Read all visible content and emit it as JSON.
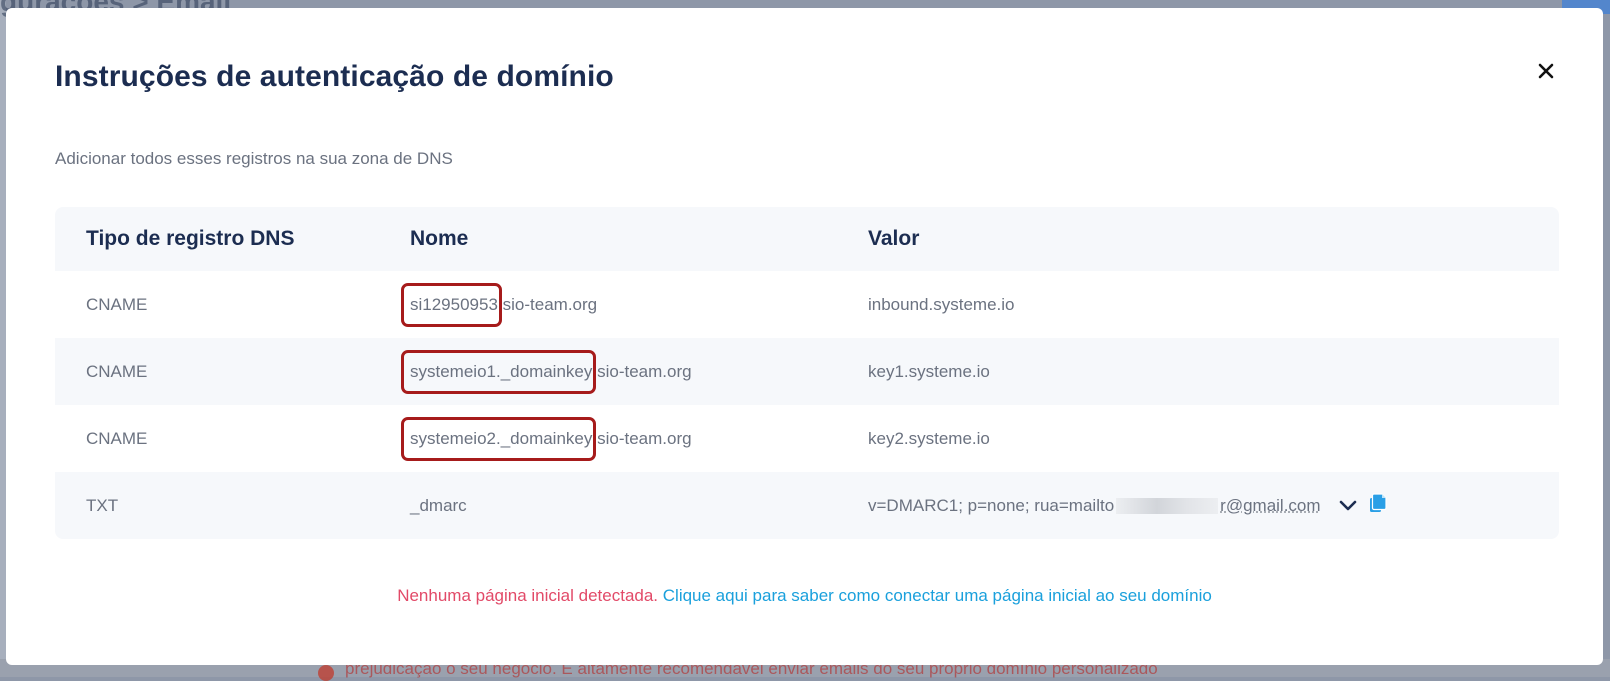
{
  "background": {
    "breadcrumb": "gurações  >  Email",
    "warning_line": "prejudicação o seu negócio. É altamente recomendável enviar emails do seu próprio domínio personalizado"
  },
  "modal": {
    "title": "Instruções de autenticação de domínio",
    "subtitle": "Adicionar todos esses registros na sua zona de DNS",
    "close_icon": "close-icon",
    "table": {
      "headers": [
        "Tipo de registro DNS",
        "Nome",
        "Valor"
      ],
      "rows": [
        {
          "type": "CNAME",
          "name_highlight": "si12950953",
          "name_rest": ".sio-team.org",
          "value": "inbound.systeme.io"
        },
        {
          "type": "CNAME",
          "name_highlight": "systemeio1._domainkey",
          "name_rest": ".sio-team.org",
          "value": "key1.systeme.io"
        },
        {
          "type": "CNAME",
          "name_highlight": "systemeio2._domainkey",
          "name_rest": ".sio-team.org",
          "value": "key2.systeme.io"
        },
        {
          "type": "TXT",
          "name": "_dmarc",
          "value_prefix": "v=DMARC1; p=none; rua=mailto",
          "value_suffix": "r@gmail.com",
          "expand_icon": "chevron-down-icon",
          "copy_icon": "copy-icon"
        }
      ]
    },
    "footer": {
      "warning": "Nenhuma página inicial detectada.",
      "link": "Clique aqui para saber como conectar uma página inicial ao seu domínio"
    }
  },
  "colors": {
    "title": "#1c2d51",
    "highlight_border": "#a61b1b",
    "warning": "#e24a68",
    "link": "#1aa0dc",
    "copy_icon": "#2a9fe6"
  }
}
